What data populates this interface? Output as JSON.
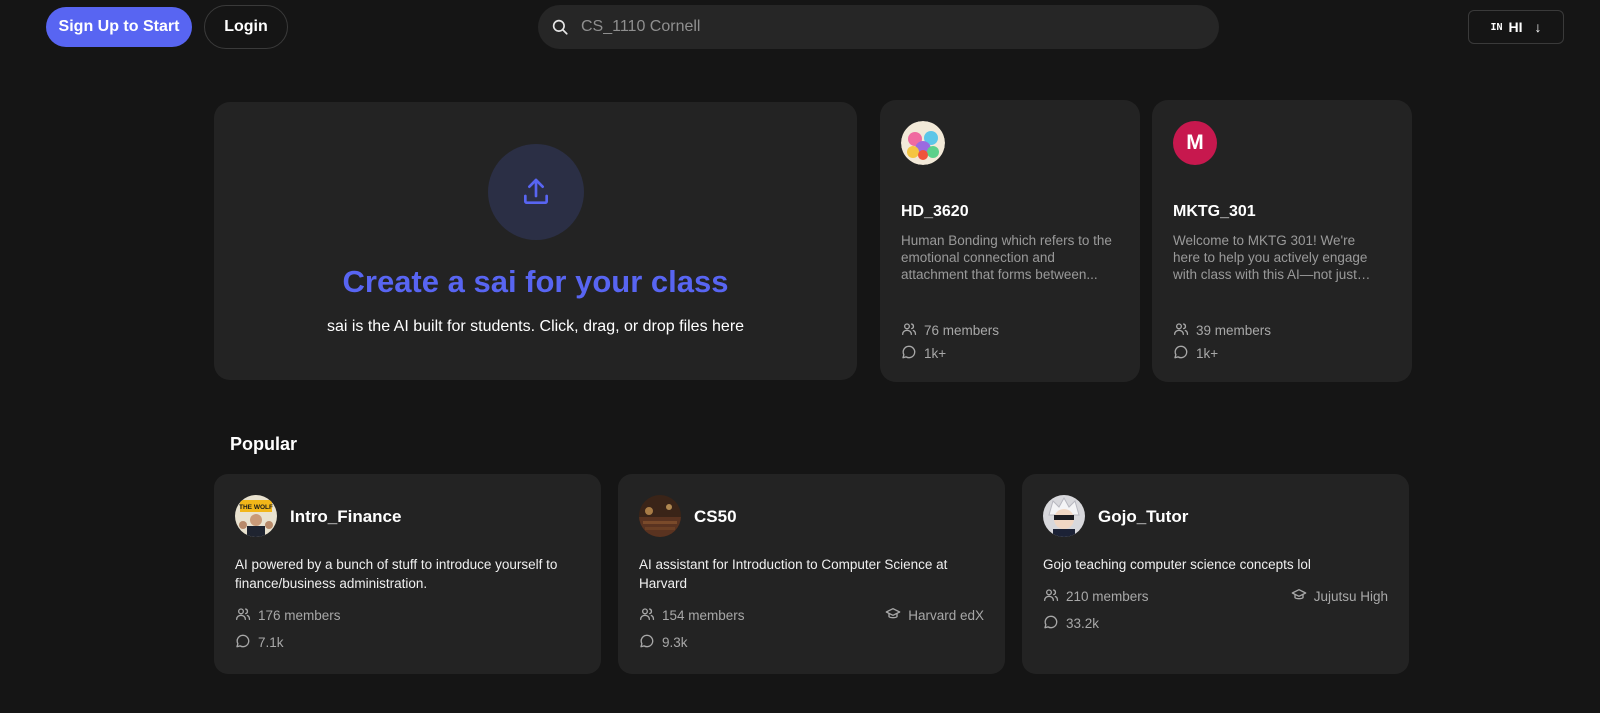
{
  "header": {
    "signup_label": "Sign Up to Start",
    "login_label": "Login",
    "search_placeholder": "CS_1110 Cornell",
    "lang_flag": "IN",
    "lang_label": "HI",
    "lang_arrow": "↓"
  },
  "create": {
    "title": "Create a sai for your class",
    "subtitle": "sai is the AI built for students. Click, drag, or drop files here"
  },
  "featured": [
    {
      "name": "HD_3620",
      "description": "Human Bonding which refers to the emotional connection and attachment that forms between...",
      "members": "76 members",
      "chats": "1k+",
      "avatar_letter": ""
    },
    {
      "name": "MKTG_301",
      "description": "Welcome to MKTG 301! We're here to help you actively engage with class with this AI—not just share...",
      "members": "39 members",
      "chats": "1k+",
      "avatar_letter": "M"
    }
  ],
  "popular": {
    "title": "Popular",
    "items": [
      {
        "name": "Intro_Finance",
        "description": "AI powered by a bunch of stuff to introduce yourself to finance/business administration.",
        "members": "176 members",
        "chats": "7.1k",
        "school": "",
        "avatar_text": "THE WOLF"
      },
      {
        "name": "CS50",
        "description": "AI assistant for Introduction to Computer Science at Harvard",
        "members": "154 members",
        "chats": "9.3k",
        "school": "Harvard edX"
      },
      {
        "name": "Gojo_Tutor",
        "description": "Gojo teaching computer science concepts lol",
        "members": "210 members",
        "chats": "33.2k",
        "school": "Jujutsu High"
      }
    ]
  },
  "colors": {
    "accent": "#5865f2",
    "background": "#151515",
    "card": "#232323"
  },
  "icons": [
    "search-icon",
    "upload-icon",
    "members-icon",
    "chat-icon",
    "school-icon"
  ]
}
